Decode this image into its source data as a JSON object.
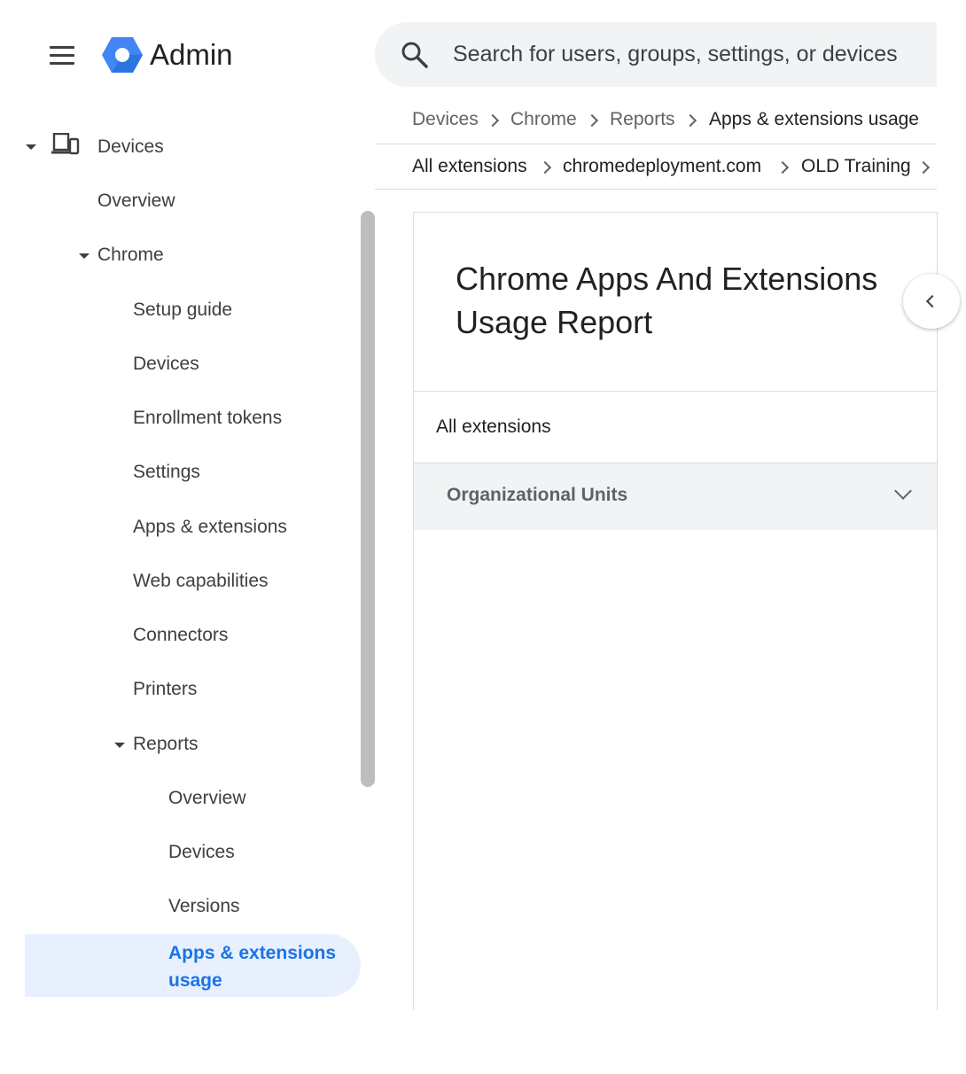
{
  "header": {
    "app_title": "Admin",
    "search_placeholder": "Search for users, groups, settings, or devices"
  },
  "sidebar": {
    "devices": "Devices",
    "overview": "Overview",
    "chrome": "Chrome",
    "chrome_items": [
      "Setup guide",
      "Devices",
      "Enrollment tokens",
      "Settings",
      "Apps & extensions",
      "Web capabilities",
      "Connectors",
      "Printers"
    ],
    "reports": "Reports",
    "report_items": [
      "Overview",
      "Devices",
      "Versions"
    ],
    "active_line1": "Apps & extensions",
    "active_line2": "usage"
  },
  "breadcrumb": [
    "Devices",
    "Chrome",
    "Reports",
    "Apps & extensions usage"
  ],
  "sub_breadcrumb": [
    "All extensions",
    "chromedeployment.com",
    "OLD Training"
  ],
  "card": {
    "title_line1": "Chrome Apps And Extensions",
    "title_line2": "Usage Report",
    "all_extensions": "All extensions",
    "org_units": "Organizational Units"
  },
  "colors": {
    "accent": "#1a73e8",
    "active_bg": "#e8f0fe"
  },
  "icons": [
    "menu-icon",
    "admin-logo-icon",
    "search-icon",
    "devices-icon",
    "chevron-down-icon",
    "chevron-left-icon",
    "chevron-right-icon"
  ]
}
